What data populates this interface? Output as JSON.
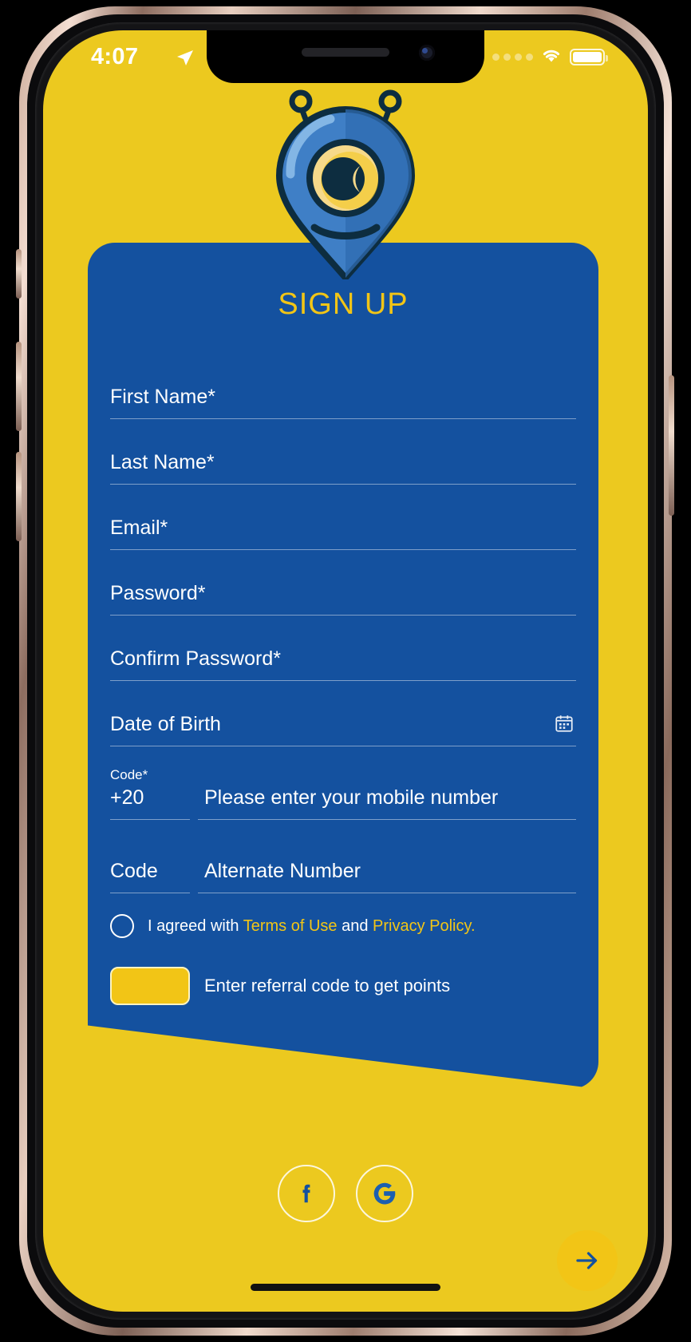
{
  "status_bar": {
    "time": "4:07",
    "location_icon": "location-arrow-icon",
    "signal_icon": "signal-dots-icon",
    "wifi_icon": "wifi-icon",
    "battery_icon": "battery-full-icon"
  },
  "brand": {
    "logo_name": "alien-map-pin-mascot",
    "background_color": "#ecc91f",
    "card_color": "#14519f",
    "accent_color": "#f2c516"
  },
  "card": {
    "title": "SIGN UP",
    "fields": [
      {
        "name": "first-name",
        "placeholder": "First Name*",
        "value": ""
      },
      {
        "name": "last-name",
        "placeholder": "Last Name*",
        "value": ""
      },
      {
        "name": "email",
        "placeholder": "Email*",
        "value": ""
      },
      {
        "name": "password",
        "placeholder": "Password*",
        "value": ""
      },
      {
        "name": "confirm-password",
        "placeholder": "Confirm Password*",
        "value": ""
      },
      {
        "name": "date-of-birth",
        "placeholder": "Date of Birth",
        "value": "",
        "icon": "calendar-icon"
      }
    ],
    "phone_primary": {
      "code_label": "Code*",
      "code_value": "+20",
      "number_placeholder": "Please enter your mobile number",
      "number_value": ""
    },
    "phone_alternate": {
      "code_placeholder": "Code",
      "code_value": "",
      "number_placeholder": "Alternate Number",
      "number_value": ""
    },
    "terms": {
      "checked": false,
      "prefix": "I agreed with ",
      "terms_link": "Terms of Use",
      "conjunction": " and ",
      "privacy_link": "Privacy Policy."
    },
    "referral": {
      "input_value": "",
      "label": "Enter referral code to get points"
    },
    "submit_icon": "arrow-right-icon"
  },
  "social": {
    "facebook_icon": "facebook-icon",
    "google_icon": "google-icon"
  }
}
